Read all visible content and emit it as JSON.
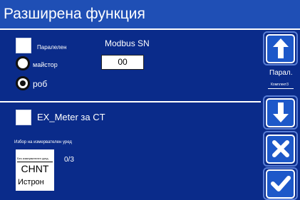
{
  "title": "Разширена функция",
  "parallel": {
    "checkbox_label": "Паралелен",
    "radio_master_label": "майстор",
    "radio_slave_label": "роб",
    "selected": "slave"
  },
  "modbus": {
    "label": "Modbus SN",
    "value": "00"
  },
  "ex_meter": {
    "label": "EX_Meter за CT"
  },
  "meter_select": {
    "caption": "Избор на измервателен уред",
    "tile_small_label": "Без измервателен уред",
    "tile_brand": "CHNT",
    "tile_option": "Истрон",
    "counter": "0/3"
  },
  "side": {
    "page_label": "Парал.",
    "page_sub_label": "Комплект3"
  },
  "colors": {
    "title_bg": "#1f4fb5",
    "panel_bg": "#0a2b8a",
    "button_face": "#1d58c9"
  }
}
